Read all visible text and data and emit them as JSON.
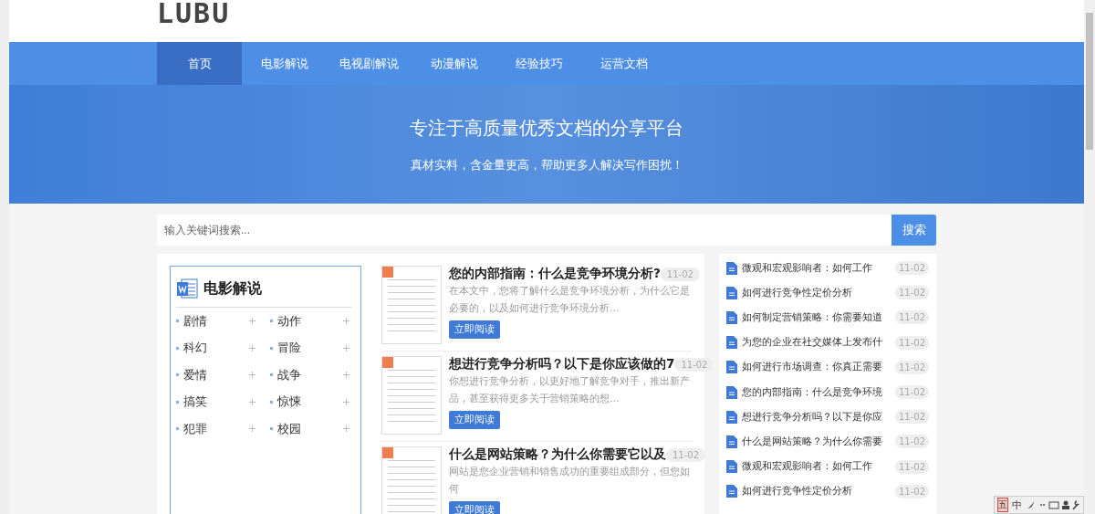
{
  "logo": "LUBU",
  "nav": [
    {
      "label": "首页",
      "selected": true
    },
    {
      "label": "电影解说",
      "selected": false
    },
    {
      "label": "电视剧解说",
      "selected": false
    },
    {
      "label": "动漫解说",
      "selected": false
    },
    {
      "label": "经验技巧",
      "selected": false
    },
    {
      "label": "运营文档",
      "selected": false
    }
  ],
  "hero": {
    "title": "专注于高质量优秀文档的分享平台",
    "subtitle": "真材实料，含金量更高，帮助更多人解决写作困扰！"
  },
  "search": {
    "placeholder": "输入关键词搜索...",
    "button": "搜索"
  },
  "category": {
    "title": "电影解说",
    "items": [
      "剧情",
      "动作",
      "科幻",
      "冒险",
      "爱情",
      "战争",
      "搞笑",
      "惊悚",
      "犯罪",
      "校园"
    ]
  },
  "articles": [
    {
      "title": "您的内部指南：什么是竞争环境分析?",
      "date": "11-02",
      "excerpt": "在本文中，您将了解什么是竞争环境分析，为什么它是必要的，以及如何进行竞争环境分析…",
      "button": "立即阅读"
    },
    {
      "title": "想进行竞争分析吗？以下是你应该做的7",
      "date": "11-02",
      "excerpt": "你想进行竞争分析，以更好地了解竞争对手，推出新产品，甚至获得更多关于营销策略的想…",
      "button": "立即阅读"
    },
    {
      "title": "什么是网站策略？为什么你需要它以及",
      "date": "11-02",
      "excerpt": "网站是您企业营销和销售成功的重要组成部分，但您如何",
      "button": "立即阅读"
    }
  ],
  "side_list": [
    {
      "title": "微观和宏观影响者：如何工作",
      "date": "11-02"
    },
    {
      "title": "如何进行竞争性定价分析",
      "date": "11-02"
    },
    {
      "title": "如何制定营销策略：你需要知道",
      "date": "11-02"
    },
    {
      "title": "为您的企业在社交媒体上发布什",
      "date": "11-02"
    },
    {
      "title": "如何进行市场调查：你真正需要",
      "date": "11-02"
    },
    {
      "title": "您的内部指南：什么是竞争环境",
      "date": "11-02"
    },
    {
      "title": "想进行竞争分析吗？以下是你应",
      "date": "11-02"
    },
    {
      "title": "什么是网站策略？为什么你需要",
      "date": "11-02"
    },
    {
      "title": "微观和宏观影响者：如何工作",
      "date": "11-02"
    },
    {
      "title": "如何进行竞争性定价分析",
      "date": "11-02"
    }
  ],
  "ime_toolbar": [
    "五",
    "中"
  ]
}
